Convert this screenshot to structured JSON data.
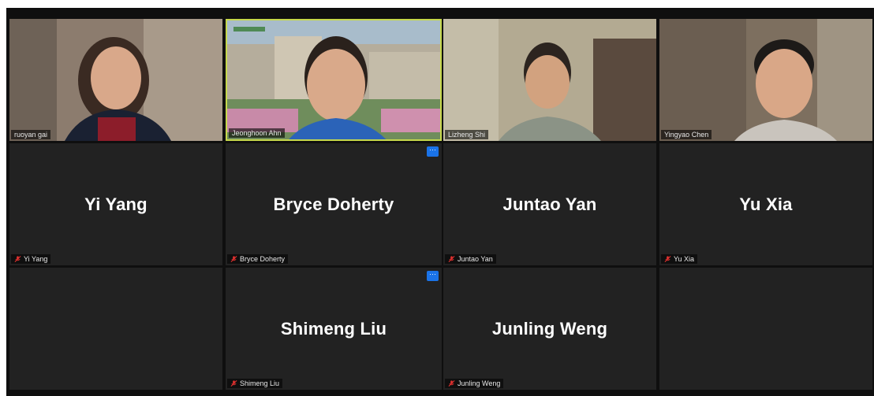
{
  "video_tiles": [
    {
      "name": "ruoyan gai"
    },
    {
      "name": "Jeonghoon Ahn"
    },
    {
      "name": "Lizheng Shi"
    },
    {
      "name": "Yingyao Chen"
    }
  ],
  "audio_tiles": [
    {
      "display_name": "Yi Yang",
      "tag": "Yi Yang"
    },
    {
      "display_name": "Bryce Doherty",
      "tag": "Bryce Doherty"
    },
    {
      "display_name": "Juntao Yan",
      "tag": "Juntao Yan"
    },
    {
      "display_name": "Yu Xia",
      "tag": "Yu Xia"
    },
    {
      "display_name": "Shimeng Liu",
      "tag": "Shimeng Liu"
    },
    {
      "display_name": "Junling Weng",
      "tag": "Junling Weng"
    }
  ],
  "more_button_label": "···",
  "colors": {
    "active_speaker_border": "#c6d84c",
    "tile_bg": "#222222",
    "muted_icon": "#e0312f",
    "more_button": "#1a73e8"
  }
}
